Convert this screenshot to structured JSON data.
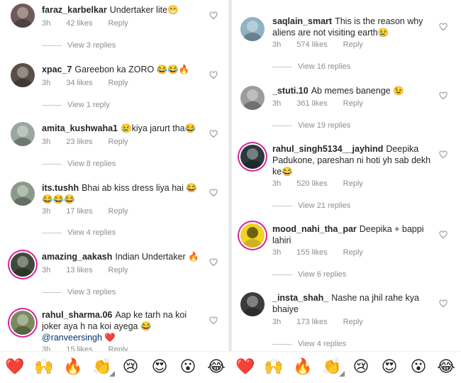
{
  "left_comments": [
    {
      "user": "faraz_karbelkar",
      "text": "Undertaker lite😁",
      "time": "3h",
      "likes": "42 likes",
      "reply": "Reply",
      "replies": "View 3 replies",
      "avatar_color": "#6e5a58",
      "ring": false
    },
    {
      "user": "xpac_7",
      "text": "Gareebon ka ZORO 😂😂🔥",
      "time": "3h",
      "likes": "34 likes",
      "reply": "Reply",
      "replies": "View 1 reply",
      "avatar_color": "#5a4e46",
      "ring": false
    },
    {
      "user": "amita_kushwaha1",
      "text": "😢kiya jarurt tha😂",
      "time": "3h",
      "likes": "23 likes",
      "reply": "Reply",
      "replies": "View 8 replies",
      "avatar_color": "#9aa6a0",
      "ring": false
    },
    {
      "user": "its.tushh",
      "text": "Bhai ab kiss dress liya hai 😂😂😂😂",
      "time": "3h",
      "likes": "17 likes",
      "reply": "Reply",
      "replies": "View 4 replies",
      "avatar_color": "#8a9a88",
      "ring": false
    },
    {
      "user": "amazing_aakash",
      "text": "Indian Undertaker 🔥",
      "time": "3h",
      "likes": "13 likes",
      "reply": "Reply",
      "replies": "View 3 replies",
      "avatar_color": "#3f4a3a",
      "ring": true
    },
    {
      "user": "rahul_sharma.06",
      "text": "Aap ke tarh na koi joker aya h na koi ayega 😂",
      "mention": "@ranveersingh ❤️",
      "time": "3h",
      "likes": "15 likes",
      "reply": "Reply",
      "replies": "",
      "avatar_color": "#7b8a5c",
      "ring": true
    }
  ],
  "right_comments": [
    {
      "user": "saqlain_smart",
      "text": "This is the reason why aliens are not visiting earth😢",
      "time": "3h",
      "likes": "574 likes",
      "reply": "Reply",
      "replies": "View 16 replies",
      "avatar_color": "#8fb3c4",
      "ring": false
    },
    {
      "user": "_stuti.10",
      "text": "Ab memes banenge 😉",
      "time": "3h",
      "likes": "361 likes",
      "reply": "Reply",
      "replies": "View 19 replies",
      "avatar_color": "#9c9c9c",
      "ring": false
    },
    {
      "user": "rahul_singh5134__jayhind",
      "text": "Deepika Padukone, pareshan ni hoti yh sab dekh ke😂",
      "time": "3h",
      "likes": "520 likes",
      "reply": "Reply",
      "replies": "View 21 replies",
      "avatar_color": "#2b3a3c",
      "ring": true
    },
    {
      "user": "mood_nahi_tha_par",
      "text": "Deepika + bappi lahiri",
      "time": "3h",
      "likes": "155 likes",
      "reply": "Reply",
      "replies": "View 6 replies",
      "avatar_color": "#f2d321",
      "ring": true
    },
    {
      "user": "_insta_shah_",
      "text": "Nashe na jhil rahe kya bhaiye",
      "time": "3h",
      "likes": "173 likes",
      "reply": "Reply",
      "replies": "View 4 replies",
      "avatar_color": "#3c3c3c",
      "ring": false
    }
  ],
  "emoji_bar": [
    "❤️",
    "🙌",
    "🔥",
    "👏",
    "😢",
    "😍",
    "😮",
    "😂",
    "❤️",
    "🙌",
    "🔥",
    "👏",
    "😢",
    "😍",
    "😮",
    "😂"
  ],
  "colors": {
    "username": "#262626",
    "meta": "#8e8e8e",
    "mention": "#003569",
    "ring": "#d6249f"
  }
}
